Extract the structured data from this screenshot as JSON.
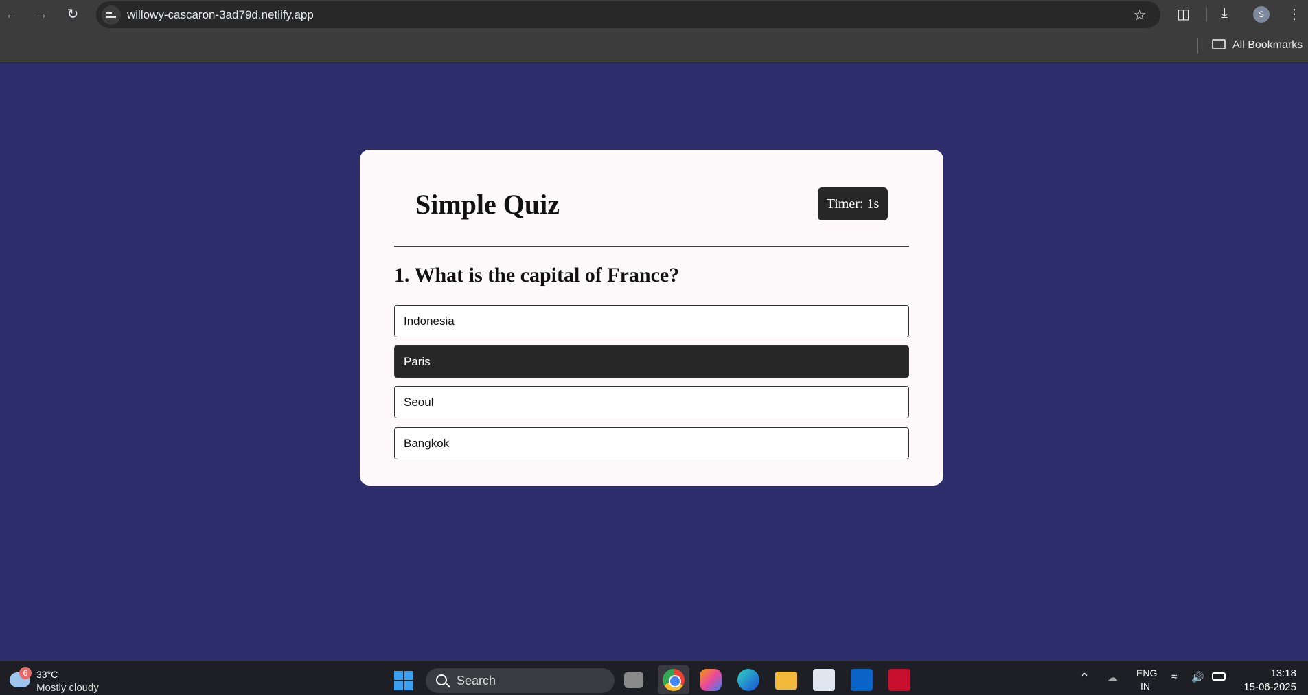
{
  "browser": {
    "url": "willowy-cascaron-3ad79d.netlify.app",
    "bookmarks_label": "All Bookmarks",
    "profile_initial": "S"
  },
  "quiz": {
    "title": "Simple Quiz",
    "timer": "Timer: 1s",
    "question": "1. What is the capital of France?",
    "options": [
      "Indonesia",
      "Paris",
      "Seoul",
      "Bangkok"
    ],
    "selected_option": "Paris"
  },
  "taskbar": {
    "weather_badge": "6",
    "weather_temp": "33°C",
    "weather_desc": "Mostly cloudy",
    "search_label": "Search",
    "language_top": "ENG",
    "language_bottom": "IN",
    "time": "13:18",
    "date": "15-06-2025"
  },
  "colors": {
    "page_background": "#2e2d6b",
    "card_background": "#fdf9fa",
    "selected_option_background": "#272727"
  }
}
